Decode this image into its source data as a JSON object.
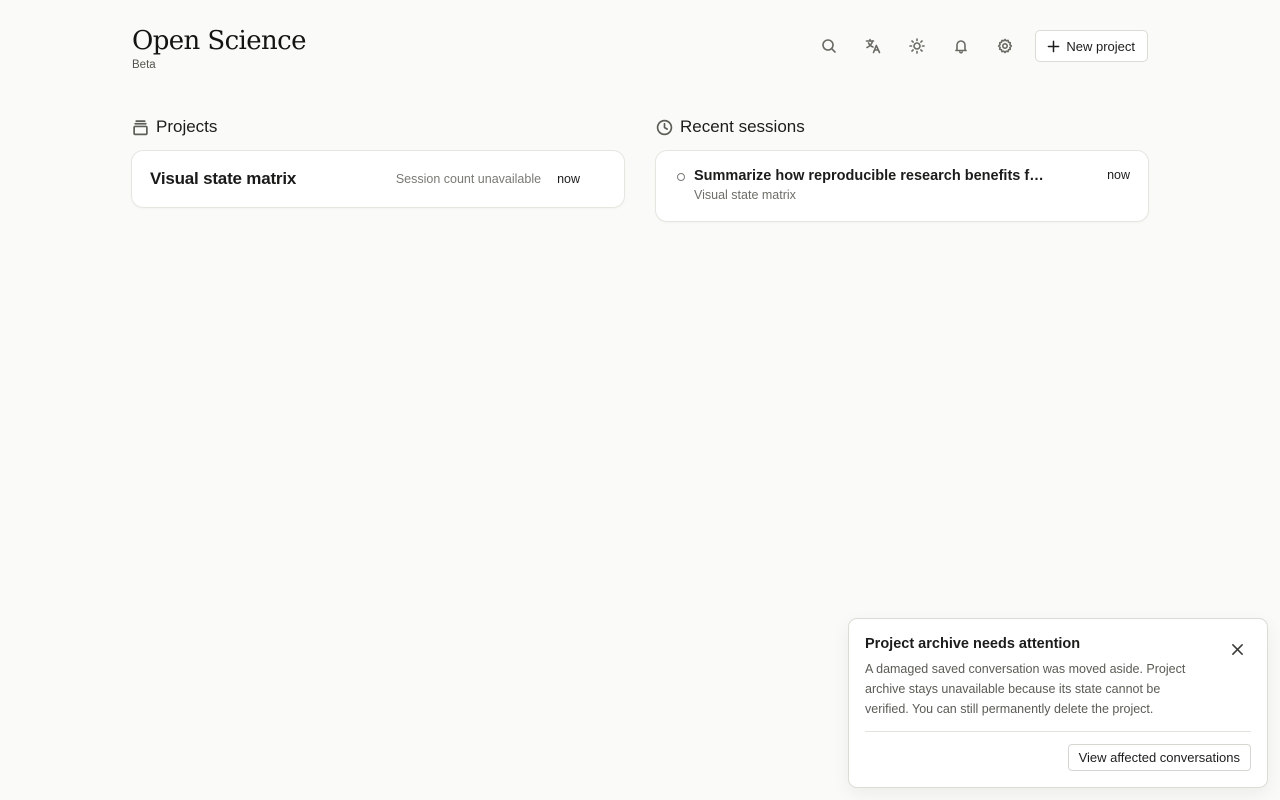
{
  "header": {
    "title": "Open Science",
    "subtitle": "Beta",
    "new_project_label": "New project"
  },
  "toolbar_icons": [
    "search-icon",
    "translate-icon",
    "theme-sun-icon",
    "bell-icon",
    "gear-icon"
  ],
  "projects": {
    "heading": "Projects",
    "items": [
      {
        "name": "Visual state matrix",
        "meta": "Session count unavailable",
        "time": "now"
      }
    ]
  },
  "recent_sessions": {
    "heading": "Recent sessions",
    "items": [
      {
        "title": "Summarize how reproducible research benefits fro...",
        "project": "Visual state matrix",
        "time": "now"
      }
    ]
  },
  "toast": {
    "title": "Project archive needs attention",
    "body": "A damaged saved conversation was moved aside. Project archive stays unavailable because its state cannot be verified. You can still permanently delete the project.",
    "action_label": "View affected conversations"
  }
}
